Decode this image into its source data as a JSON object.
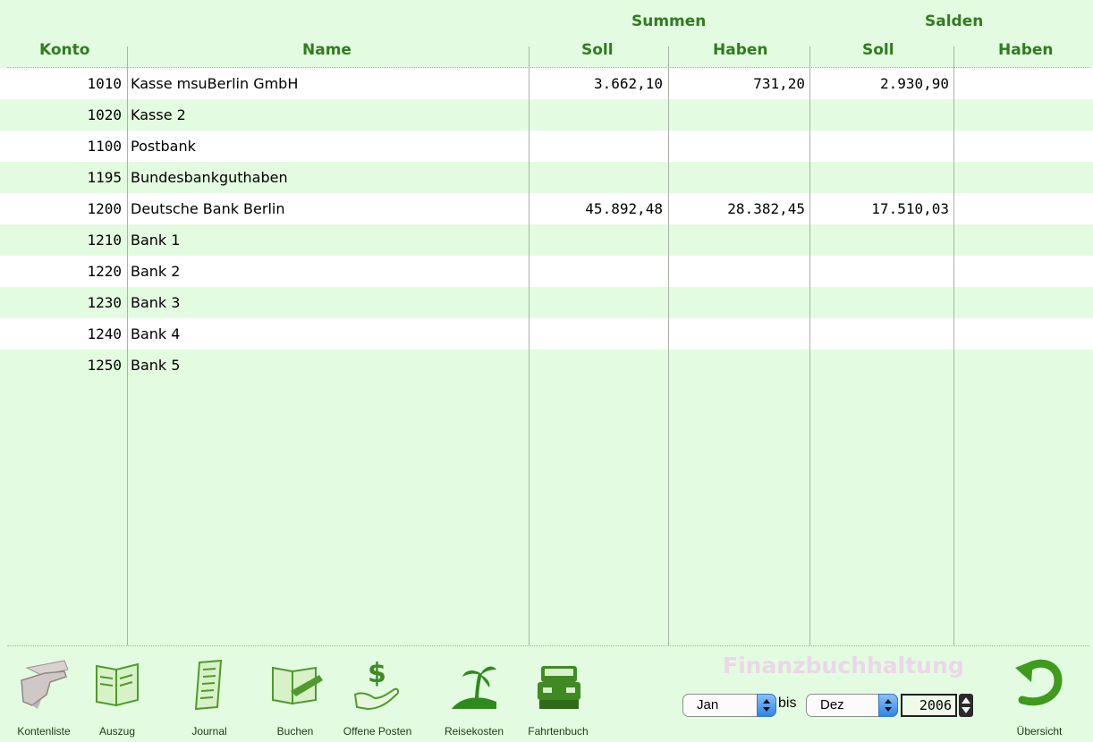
{
  "header": {
    "group_summen": "Summen",
    "group_salden": "Salden",
    "col_konto": "Konto",
    "col_name": "Name",
    "col_summen_soll": "Soll",
    "col_summen_haben": "Haben",
    "col_salden_soll": "Soll",
    "col_salden_haben": "Haben"
  },
  "rows": [
    {
      "konto": "1010",
      "name": "Kasse msuBerlin GmbH",
      "summen_soll": "3.662,10",
      "summen_haben": "731,20",
      "salden_soll": "2.930,90",
      "salden_haben": ""
    },
    {
      "konto": "1020",
      "name": "Kasse 2",
      "summen_soll": "",
      "summen_haben": "",
      "salden_soll": "",
      "salden_haben": ""
    },
    {
      "konto": "1100",
      "name": "Postbank",
      "summen_soll": "",
      "summen_haben": "",
      "salden_soll": "",
      "salden_haben": ""
    },
    {
      "konto": "1195",
      "name": "Bundesbankguthaben",
      "summen_soll": "",
      "summen_haben": "",
      "salden_soll": "",
      "salden_haben": ""
    },
    {
      "konto": "1200",
      "name": "Deutsche Bank Berlin",
      "summen_soll": "45.892,48",
      "summen_haben": "28.382,45",
      "salden_soll": "17.510,03",
      "salden_haben": ""
    },
    {
      "konto": "1210",
      "name": "Bank 1",
      "summen_soll": "",
      "summen_haben": "",
      "salden_soll": "",
      "salden_haben": ""
    },
    {
      "konto": "1220",
      "name": "Bank 2",
      "summen_soll": "",
      "summen_haben": "",
      "salden_soll": "",
      "salden_haben": ""
    },
    {
      "konto": "1230",
      "name": "Bank 3",
      "summen_soll": "",
      "summen_haben": "",
      "salden_soll": "",
      "salden_haben": ""
    },
    {
      "konto": "1240",
      "name": "Bank 4",
      "summen_soll": "",
      "summen_haben": "",
      "salden_soll": "",
      "salden_haben": ""
    },
    {
      "konto": "1250",
      "name": "Bank 5",
      "summen_soll": "",
      "summen_haben": "",
      "salden_soll": "",
      "salden_haben": ""
    }
  ],
  "toolbar": [
    {
      "label": "Kontenliste",
      "icon": "hand-card-icon"
    },
    {
      "label": "Auszug",
      "icon": "open-book-icon"
    },
    {
      "label": "Journal",
      "icon": "scroll-icon"
    },
    {
      "label": "Buchen",
      "icon": "book-pen-icon"
    },
    {
      "label": "Offene Posten",
      "icon": "hand-dollar-icon"
    },
    {
      "label": "Reisekosten",
      "icon": "island-palm-icon"
    },
    {
      "label": "Fahrtenbuch",
      "icon": "car-icon"
    }
  ],
  "footer": {
    "brand": "Finanzbuchhaltung",
    "from_month": "Jan",
    "separator": "bis",
    "to_month": "Dez",
    "year": "2006",
    "overview_label": "Übersicht"
  },
  "colors": {
    "background": "#e3fbe0",
    "header_text": "#2f7d1e",
    "row_alt": "#ffffff",
    "brand_text": "#ebd7e8"
  }
}
